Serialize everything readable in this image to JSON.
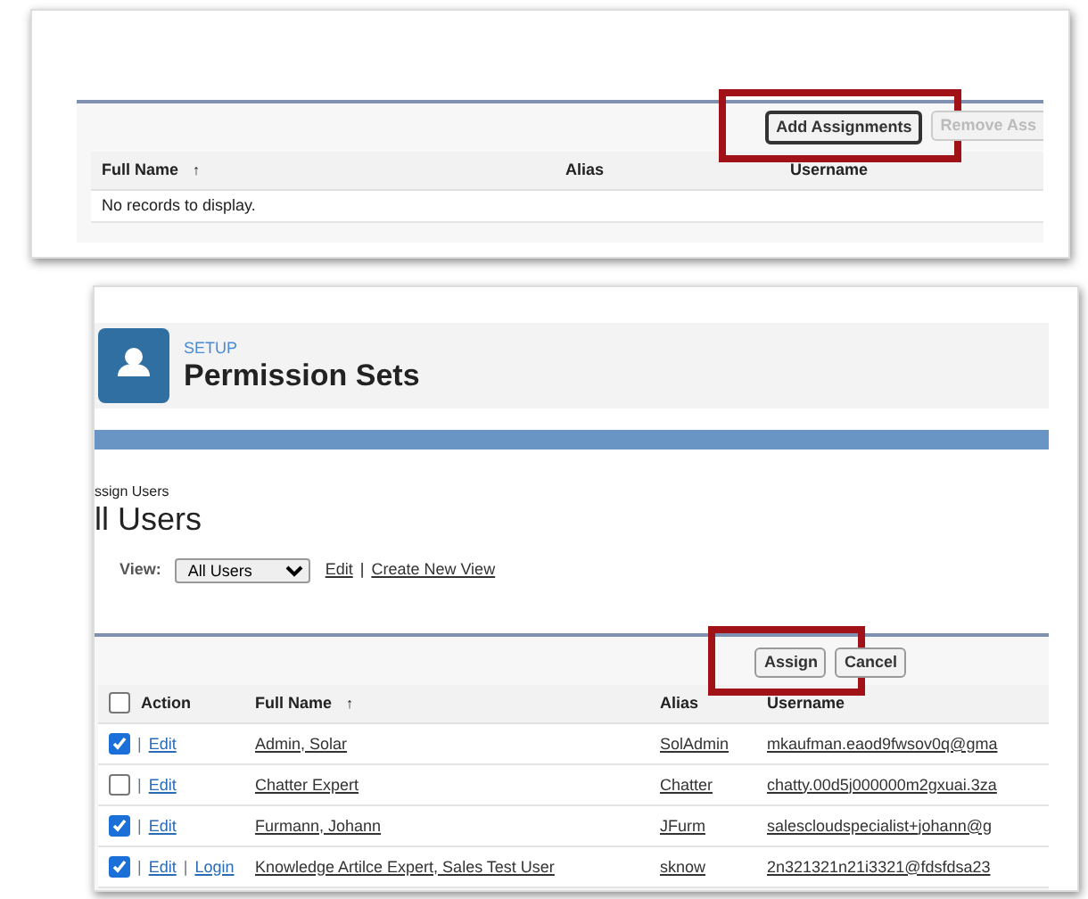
{
  "assignments_panel": {
    "buttons": [
      {
        "label": "Add Assignments",
        "disabled": false,
        "highlighted": true
      },
      {
        "label": "Remove Ass",
        "disabled": true,
        "highlighted": false
      }
    ],
    "columns": [
      {
        "label": "Full Name",
        "sort": "↑"
      },
      {
        "label": "Alias"
      },
      {
        "label": "Username"
      }
    ],
    "empty_message": "No records to display."
  },
  "assign_page": {
    "breadcrumb": "SETUP",
    "title": "Permission Sets",
    "subtitle": "ssign Users",
    "list_title": "ll Users",
    "view": {
      "label": "View:",
      "value": "All Users",
      "links": [
        {
          "label": "Edit"
        },
        {
          "separator": "|",
          "label": "Create New View"
        }
      ]
    },
    "buttons": [
      {
        "label": "Assign",
        "disabled": false,
        "highlighted": true
      },
      {
        "label": "Cancel",
        "disabled": false,
        "highlighted": false
      }
    ],
    "select_all": false,
    "columns": [
      {
        "label": "Action"
      },
      {
        "label": "Full Name",
        "sort": "↑"
      },
      {
        "label": "Alias"
      },
      {
        "label": "Username"
      }
    ],
    "rows": [
      {
        "checked": true,
        "actions": [
          {
            "separator": "|",
            "label": "Edit"
          }
        ],
        "full_name": "Admin, Solar",
        "alias": "SolAdmin",
        "username": "mkaufman.eaod9fwsov0q@gma"
      },
      {
        "checked": false,
        "actions": [
          {
            "separator": "|",
            "label": "Edit"
          }
        ],
        "full_name": "Chatter Expert",
        "alias": "Chatter",
        "username": "chatty.00d5j000000m2gxuai.3za"
      },
      {
        "checked": true,
        "actions": [
          {
            "separator": "|",
            "label": "Edit"
          }
        ],
        "full_name": "Furmann, Johann",
        "alias": "JFurm",
        "username": "salescloudspecialist+johann@g"
      },
      {
        "checked": true,
        "actions": [
          {
            "separator": "|",
            "label": "Edit"
          },
          {
            "separator": "|",
            "label": "Login"
          }
        ],
        "full_name": "Knowledge Artilce Expert, Sales Test User",
        "alias": "sknow",
        "username": "2n321321n21i3321@fdsfdsa23"
      }
    ]
  }
}
